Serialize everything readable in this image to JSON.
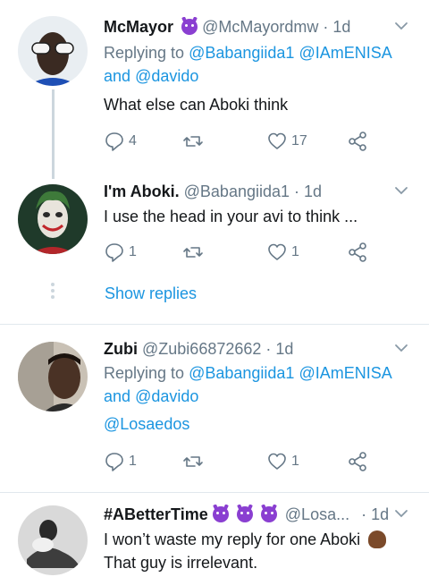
{
  "tweets": [
    {
      "name": "McMayor",
      "handle": "@McMayordmw",
      "time": "· 1d",
      "replying_prefix": "Replying to",
      "replying_handles_line1": "@Babangiida1 @IAmENISA",
      "replying_and": "and",
      "replying_handle_line2": "@davido",
      "text": "What else can Aboki think",
      "reply_count": "4",
      "retweet_count": "",
      "like_count": "17"
    },
    {
      "name": "I'm Aboki.",
      "handle": "@Babangiida1",
      "time": "· 1d",
      "text": "I use the head in your avi to think ...",
      "reply_count": "1",
      "retweet_count": "",
      "like_count": "1",
      "show_replies": "Show replies"
    },
    {
      "name": "Zubi",
      "handle": "@Zubi66872662",
      "time": "· 1d",
      "replying_prefix": "Replying to",
      "replying_handles_line1": "@Babangiida1 @IAmENISA",
      "replying_and": "and",
      "replying_handle_line2": "@davido",
      "mention": "@Losaedos",
      "reply_count": "1",
      "retweet_count": "",
      "like_count": "1"
    },
    {
      "name": "#ABetterTime",
      "handle": "@Losa...",
      "time": "· 1d",
      "text_line1": "I won’t waste my reply for one Aboki",
      "text_line2": "That guy is irrelevant."
    }
  ]
}
